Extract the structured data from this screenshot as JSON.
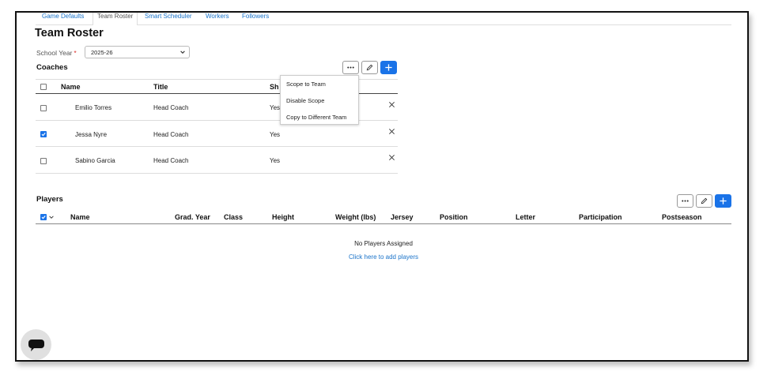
{
  "tabs": [
    "Game Defaults",
    "Team Roster",
    "Smart Scheduler",
    "Workers",
    "Followers"
  ],
  "page": {
    "title": "Team Roster"
  },
  "school_year": {
    "label": "School Year",
    "required_mark": "*",
    "value": "2025-26"
  },
  "coaches": {
    "title": "Coaches",
    "columns": [
      "Name",
      "Title",
      "Sh"
    ],
    "rows": [
      {
        "name": "Emilio Torres",
        "title": "Head Coach",
        "shown": "Yes",
        "checked": false
      },
      {
        "name": "Jessa Nyre",
        "title": "Head Coach",
        "shown": "Yes",
        "checked": true
      },
      {
        "name": "Sabino Garcia",
        "title": "Head Coach",
        "shown": "Yes",
        "checked": false
      }
    ],
    "first_row_partial": "Yes"
  },
  "menu": {
    "items": [
      "Scope to Team",
      "Disable Scope",
      "Copy to Different Team"
    ]
  },
  "players": {
    "title": "Players",
    "columns": [
      "Name",
      "Grad. Year",
      "Class",
      "Height",
      "Weight (lbs)",
      "Jersey",
      "Position",
      "Letter",
      "Participation",
      "Postseason"
    ],
    "empty_message": "No Players Assigned",
    "add_link": "Click here to add players"
  },
  "icons": {
    "more": "more-horizontal-icon",
    "edit": "pencil-icon",
    "add": "plus-icon",
    "remove": "close-icon",
    "chat": "chat-icon"
  },
  "colors": {
    "accent": "#1a73e8",
    "link": "#1a73c9",
    "required": "#d9302c"
  }
}
